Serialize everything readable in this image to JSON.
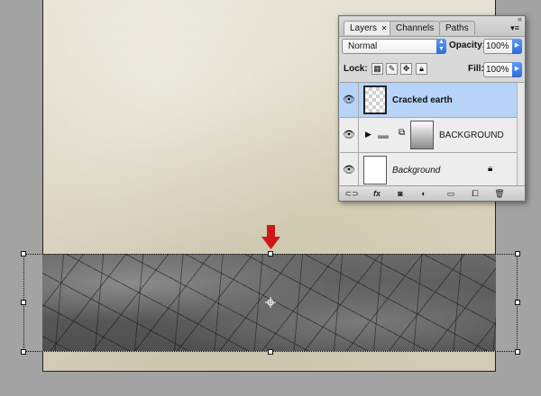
{
  "panel": {
    "tabs": [
      {
        "label": "Layers",
        "close": "✕"
      },
      {
        "label": "Channels"
      },
      {
        "label": "Paths"
      }
    ],
    "collapse_icon": "double-chevron-icon",
    "blend_mode": "Normal",
    "opacity_label": "Opacity:",
    "opacity_value": "100%",
    "lock_label": "Lock:",
    "fill_label": "Fill:",
    "fill_value": "100%",
    "layers": [
      {
        "name": "Cracked earth",
        "selected": true,
        "visible": true
      },
      {
        "name": "BACKGROUND",
        "type": "group",
        "visible": true
      },
      {
        "name": "Background",
        "locked": true,
        "visible": true
      }
    ],
    "bottom_buttons": [
      "link-layers-icon",
      "fx-icon",
      "add-mask-icon",
      "adjustment-layer-icon",
      "new-group-icon",
      "new-layer-icon",
      "trash-icon"
    ],
    "fx_label": "fx"
  },
  "colors": {
    "arrow": "#d01818",
    "selected_row": "#b7d3f7",
    "stepper_blue": "#2b6cd8"
  }
}
